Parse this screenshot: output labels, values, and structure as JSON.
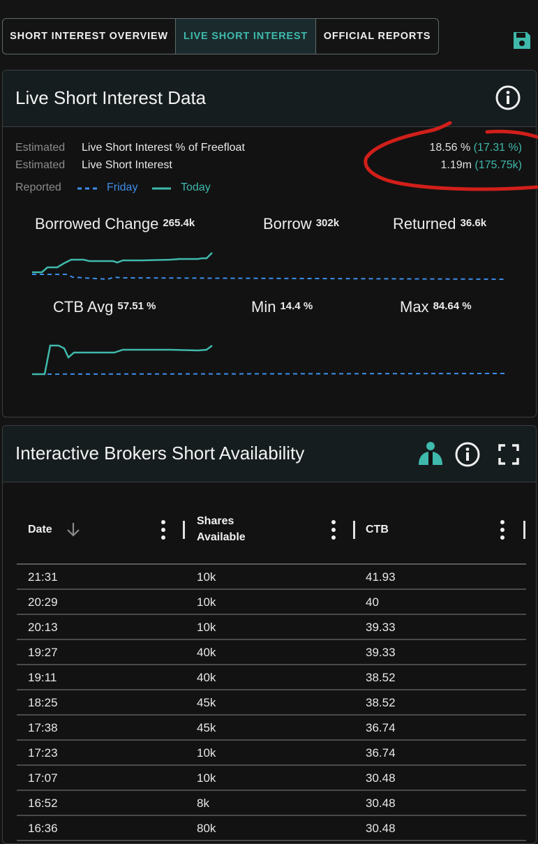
{
  "tabs": [
    {
      "label": "SHORT INTEREST OVERVIEW",
      "active": false
    },
    {
      "label": "LIVE SHORT INTEREST",
      "active": true
    },
    {
      "label": "OFFICIAL REPORTS",
      "active": false
    }
  ],
  "colors": {
    "accent": "#3fb9ac",
    "reported": "#3d8ee8",
    "annotation": "#d21f1a"
  },
  "live": {
    "title": "Live Short Interest Data",
    "rows": [
      {
        "prefix": "Estimated",
        "label": "Live Short Interest % of Freefloat",
        "value": "18.56 %",
        "reported": "(17.31 %)"
      },
      {
        "prefix": "Estimated",
        "label": "Live Short Interest",
        "value": "1.19m",
        "reported": "(175.75k)"
      }
    ],
    "legend": {
      "prefix": "Reported",
      "friday": "Friday",
      "today": "Today"
    },
    "stats_row1": [
      {
        "label": "Borrowed Change",
        "value": "265.4k"
      },
      {
        "label": "Borrow",
        "value": "302k"
      },
      {
        "label": "Returned",
        "value": "36.6k"
      }
    ],
    "stats_row2": [
      {
        "label": "CTB Avg",
        "value": "57.51 %"
      },
      {
        "label": "Min",
        "value": "14.4 %"
      },
      {
        "label": "Max",
        "value": "84.64 %"
      }
    ]
  },
  "ib": {
    "title": "Interactive Brokers Short Availability",
    "columns": [
      {
        "label": "Date"
      },
      {
        "label_line1": "Shares",
        "label_line2": "Available"
      },
      {
        "label": "CTB"
      }
    ],
    "rows": [
      {
        "date": "21:31",
        "shares": "10k",
        "ctb": "41.93"
      },
      {
        "date": "20:29",
        "shares": "10k",
        "ctb": "40"
      },
      {
        "date": "20:13",
        "shares": "10k",
        "ctb": "39.33"
      },
      {
        "date": "19:27",
        "shares": "40k",
        "ctb": "39.33"
      },
      {
        "date": "19:11",
        "shares": "40k",
        "ctb": "38.52"
      },
      {
        "date": "18:25",
        "shares": "45k",
        "ctb": "38.52"
      },
      {
        "date": "17:38",
        "shares": "45k",
        "ctb": "36.74"
      },
      {
        "date": "17:23",
        "shares": "10k",
        "ctb": "36.74"
      },
      {
        "date": "17:07",
        "shares": "10k",
        "ctb": "30.48"
      },
      {
        "date": "16:52",
        "shares": "8k",
        "ctb": "30.48"
      },
      {
        "date": "16:36",
        "shares": "80k",
        "ctb": "30.48"
      }
    ]
  }
}
